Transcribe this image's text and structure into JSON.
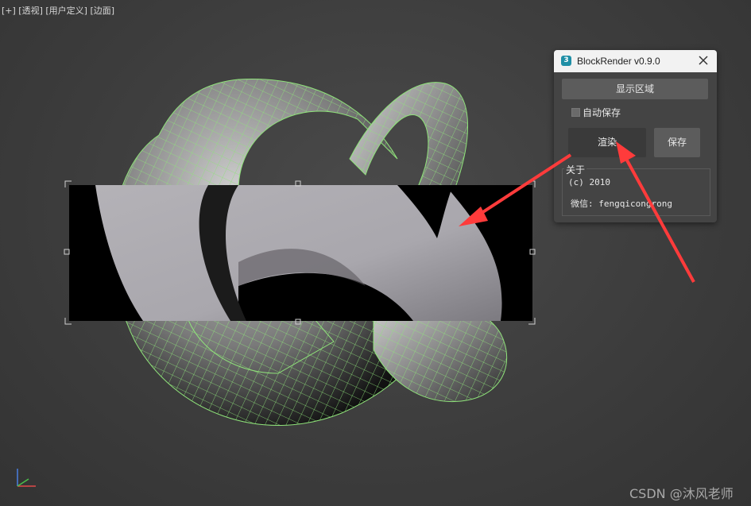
{
  "viewport": {
    "label": "[+] [透视] [用户定义] [边面]"
  },
  "dialog": {
    "title": "BlockRender v0.9.0",
    "app_icon_text": "3",
    "close_icon": "close-icon",
    "show_region_label": "显示区域",
    "autosave_label": "自动保存",
    "autosave_checked": false,
    "render_label": "渲染",
    "save_label": "保存",
    "about_title": "关于",
    "copyright": "(c) 2010",
    "wechat": "微信: fengqicongrong"
  },
  "annotation": {
    "arrow_color": "#ff3b3b"
  },
  "watermark": "CSDN @沐风老师",
  "colors": {
    "wireframe": "#8fe37a",
    "viewport_bg": "#404040",
    "dialog_bg": "#444444"
  }
}
